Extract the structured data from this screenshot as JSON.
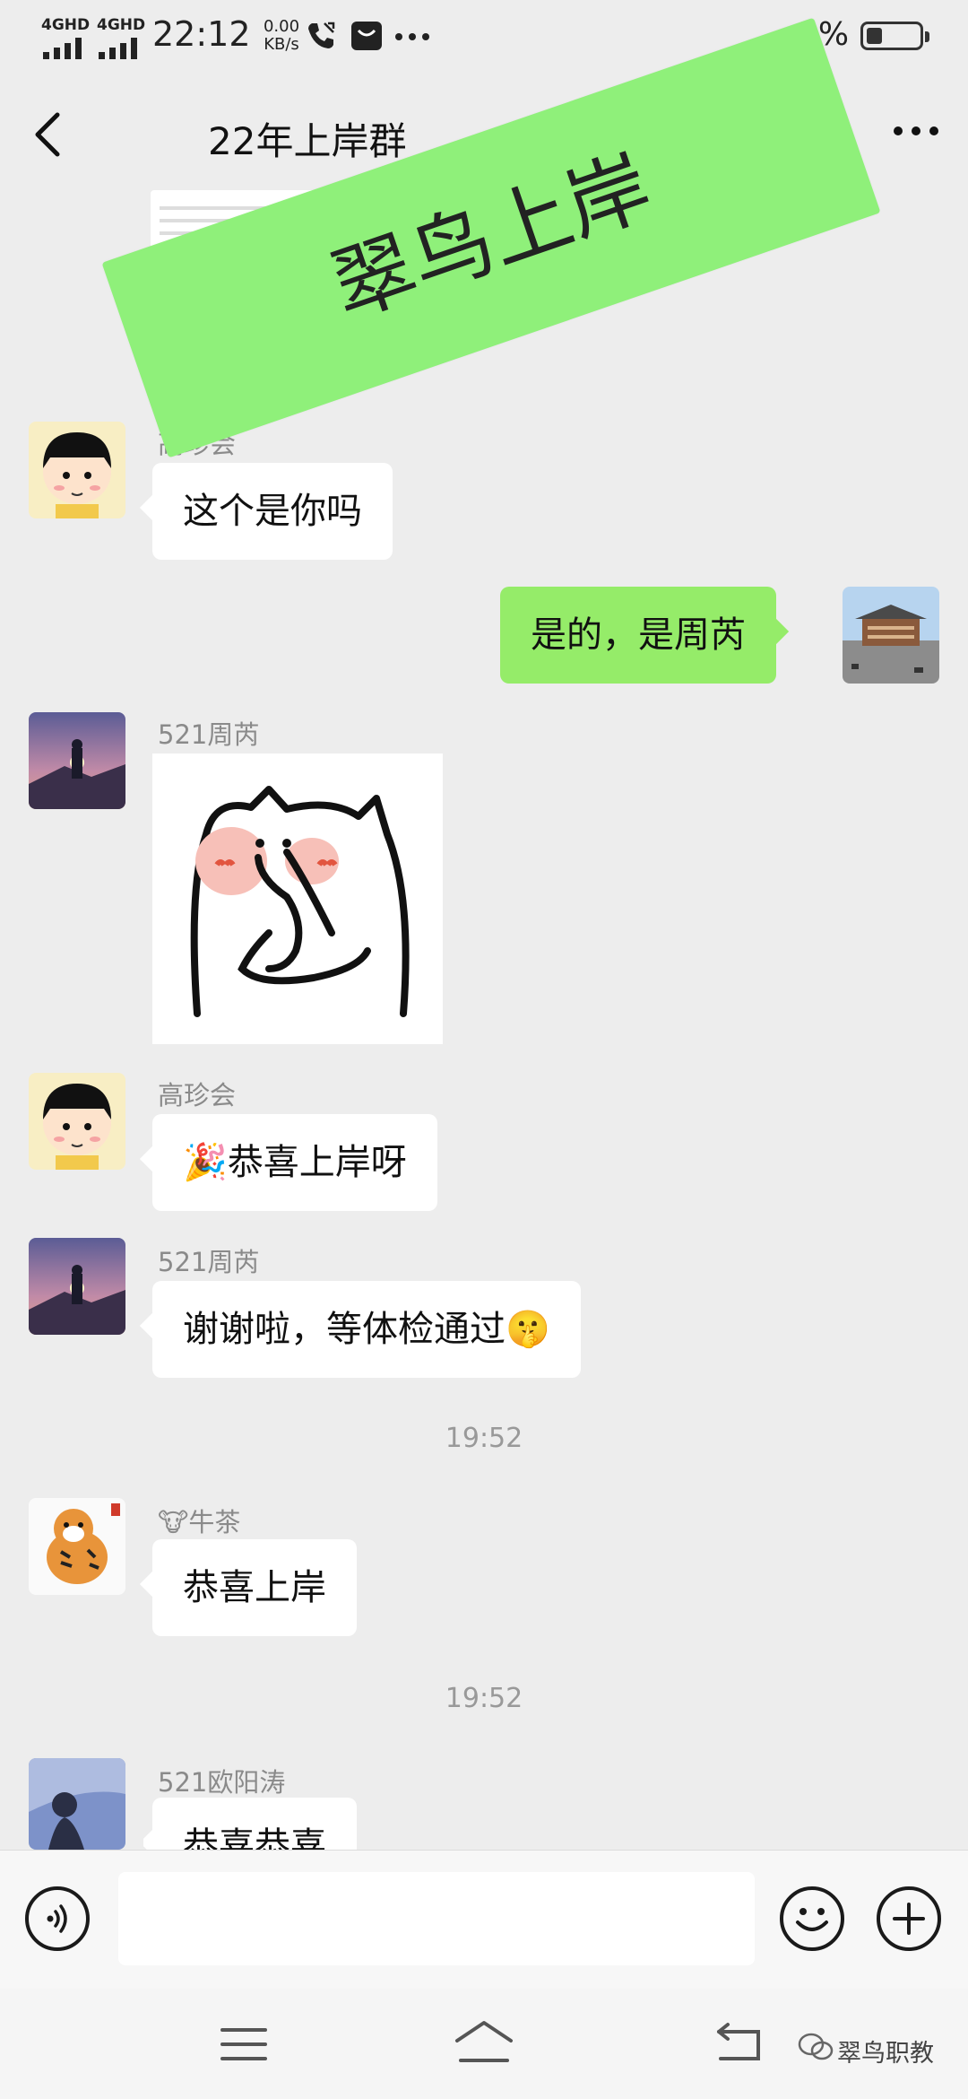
{
  "status_bar": {
    "network_1": "4GHD",
    "network_2": "4GHD",
    "time": "22:12",
    "speed_value": "0.00",
    "speed_unit": "KB/s",
    "battery_text": "3%",
    "battery_level": 0.3
  },
  "header": {
    "title": "22年上岸群",
    "back_icon": "chevron-left-icon",
    "more_icon": "more-dots-icon"
  },
  "watermark": {
    "text": "翠鸟上岸"
  },
  "messages": [
    {
      "type": "file-preview",
      "sender": ""
    },
    {
      "type": "text",
      "sender": "高珍会",
      "text": "这个是你吗",
      "side": "left"
    },
    {
      "type": "text",
      "sender": "",
      "text": "是的，是周芮",
      "side": "right"
    },
    {
      "type": "sticker",
      "sender": "521周芮",
      "side": "left"
    },
    {
      "type": "text",
      "sender": "高珍会",
      "emoji": "🎉",
      "text": "恭喜上岸呀",
      "side": "left"
    },
    {
      "type": "text",
      "sender": "521周芮",
      "text": "谢谢啦，等体检通过",
      "emoji": "🤫",
      "side": "left"
    },
    {
      "type": "timestamp",
      "text": "19:52"
    },
    {
      "type": "text",
      "sender": "牛茶",
      "sender_emoji": "🐮",
      "text": "恭喜上岸",
      "side": "left"
    },
    {
      "type": "timestamp",
      "text": "19:52"
    },
    {
      "type": "text",
      "sender": "521欧阳涛",
      "text": "恭喜恭喜",
      "side": "left"
    }
  ],
  "input_bar": {
    "voice_icon": "voice-icon",
    "emoji_icon": "smiley-icon",
    "add_icon": "plus-icon",
    "placeholder": ""
  },
  "system_nav": {
    "menu_icon": "menu-icon",
    "home_icon": "home-icon",
    "back_icon": "back-icon",
    "brand_text": "翠鸟职教"
  }
}
